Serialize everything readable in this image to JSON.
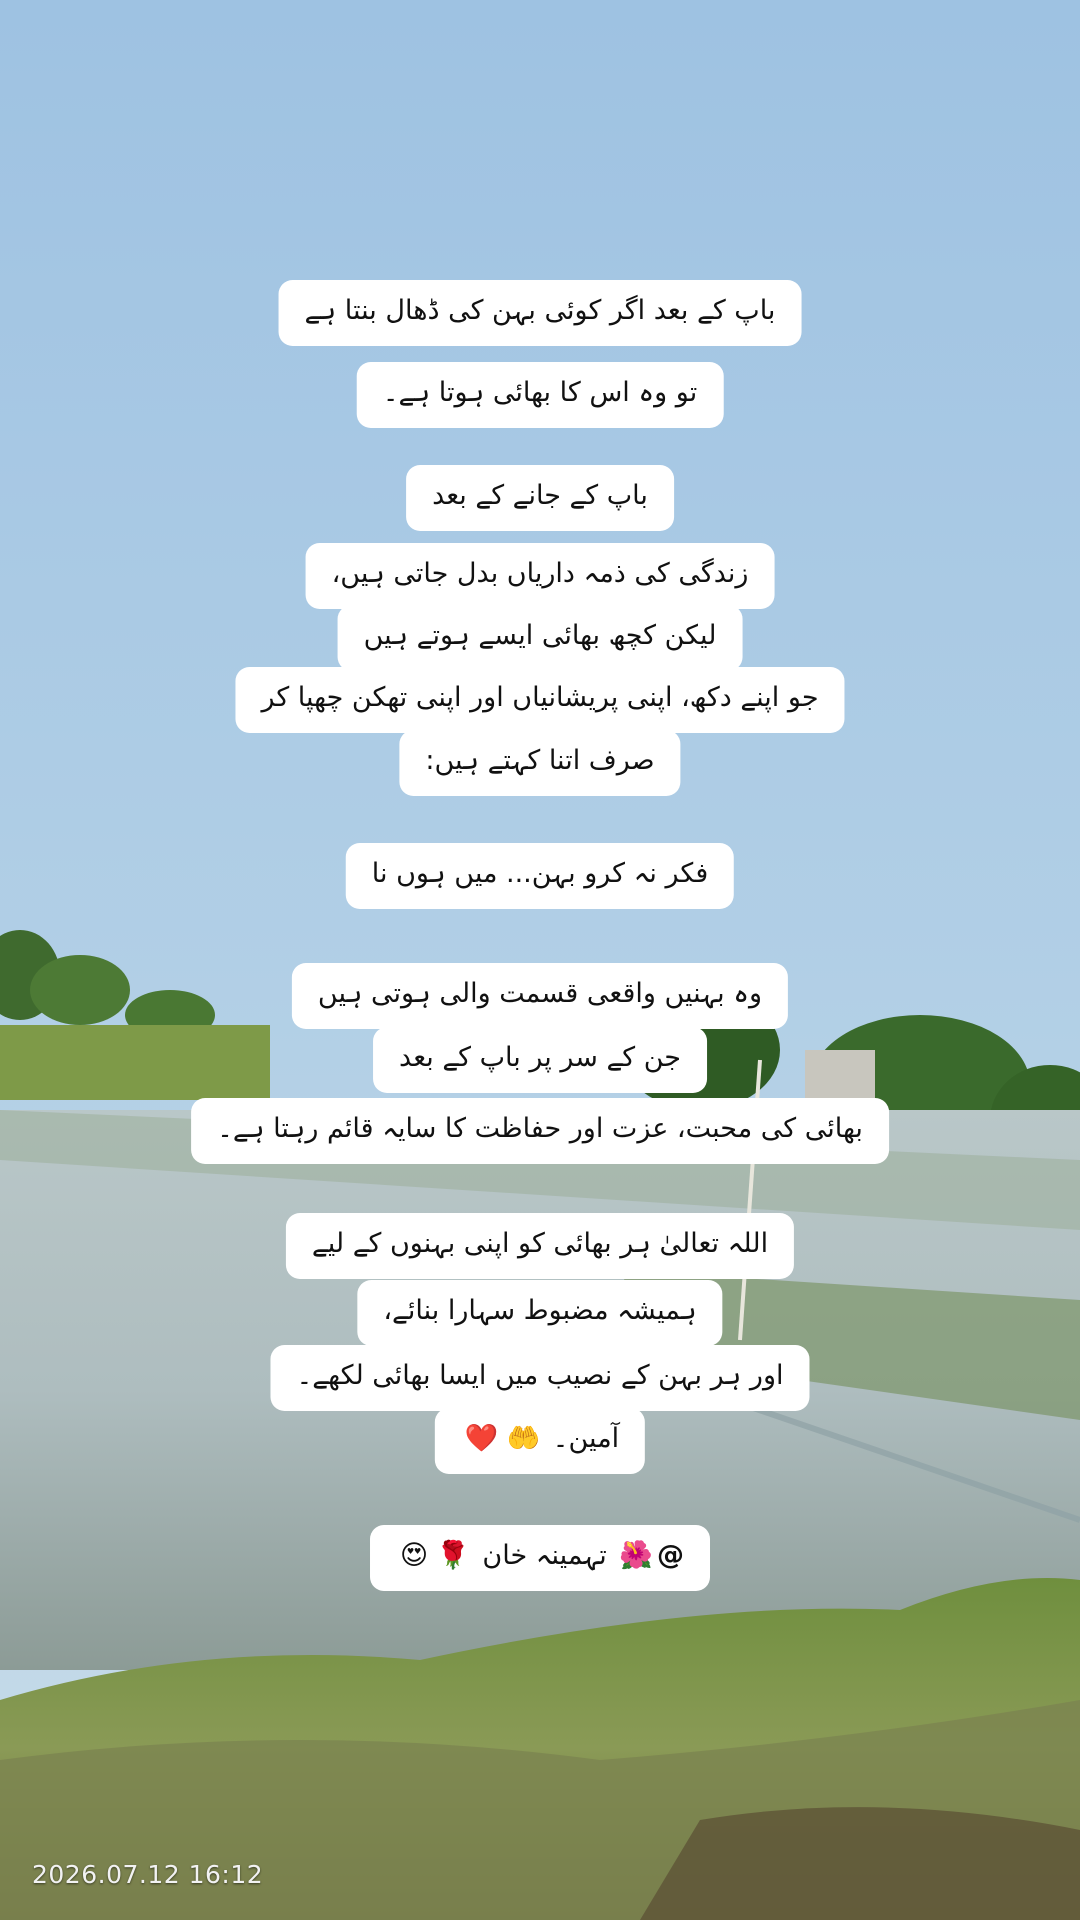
{
  "post": {
    "stanza1": {
      "line1": "باپ کے بعد اگر کوئی بہن کی ڈھال بنتا ہے",
      "line2": "تو وہ اس کا بھائی ہوتا ہے۔"
    },
    "stanza2": {
      "line1": "باپ کے جانے کے بعد",
      "line2": "زندگی کی ذمہ داریاں بدل جاتی ہیں،",
      "line3": "لیکن کچھ بھائی ایسے ہوتے ہیں",
      "line4": "جو اپنے دکھ، اپنی پریشانیاں اور اپنی تھکن چھپا کر",
      "line5": "صرف اتنا کہتے ہیں:"
    },
    "stanza3": {
      "line1": "فکر نہ کرو بہن... میں ہوں نا"
    },
    "stanza4": {
      "line1": "وہ بہنیں واقعی قسمت والی ہوتی ہیں",
      "line2": "جن کے سر پر باپ کے بعد",
      "line3": "بھائی کی محبت، عزت اور حفاظت کا سایہ قائم رہتا ہے۔"
    },
    "stanza5": {
      "line1": "اللہ تعالیٰ ہر بھائی کو اپنی بہنوں کے لیے",
      "line2": "ہمیشہ مضبوط سہارا بنائے،",
      "line3": "اور ہر بہن کے نصیب میں ایسا بھائی لکھے۔",
      "line4": "آمین۔"
    },
    "signature": {
      "handle": "@",
      "name": "تہمینہ خان"
    }
  },
  "icons": {
    "praying_hands": "praying-hands-icon",
    "heart": "heart-icon",
    "hibiscus": "hibiscus-icon",
    "rose": "rose-icon",
    "heart_eyes": "heart-eyes-emoji-icon"
  },
  "timestamp": "2026.07.12 16:12"
}
